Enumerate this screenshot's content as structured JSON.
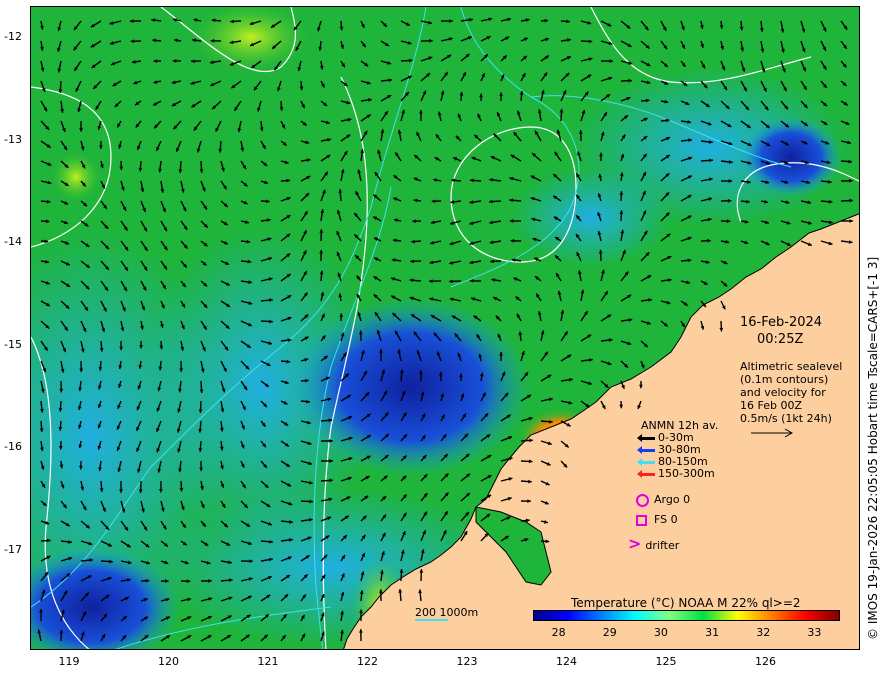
{
  "lat_ticks": [
    "-12",
    "-13",
    "-14",
    "-15",
    "-16",
    "-17"
  ],
  "lon_ticks": [
    "119",
    "120",
    "121",
    "122",
    "123",
    "124",
    "125",
    "126"
  ],
  "side_caption": "© IMOS 19-Jan-2026 22:05:05 Hobart time Tscale=CARS+[-1 3]",
  "date": "16-Feb-2024",
  "time": "00:25Z",
  "altimetry_lines": [
    "Altimetric sealevel",
    "(0.1m contours)",
    "and velocity for",
    "16 Feb 00Z",
    "0.5m/s (1kt 24h)"
  ],
  "legend": {
    "title": "ANMN 12h av.",
    "depths": [
      {
        "label": "0-30m",
        "color": "#000000"
      },
      {
        "label": "30-80m",
        "color": "#1040ff"
      },
      {
        "label": "80-150m",
        "color": "#40e0f0"
      },
      {
        "label": "150-300m",
        "color": "#ff2020"
      }
    ],
    "argo": "Argo 0",
    "fs": "FS 0",
    "drifter": "drifter"
  },
  "bathymetry_scale": "200  1000m",
  "colorbar": {
    "title": "Temperature (°C) NOAA   M 22% ql>=2",
    "ticks": [
      "28",
      "29",
      "30",
      "31",
      "32",
      "33"
    ],
    "range": [
      27.5,
      33.5
    ]
  },
  "colors": {
    "land": "#fdcf9f",
    "ocean_warm": "#1fb43a",
    "ocean_cool": "#18a8d8",
    "ocean_cold": "#1838c8",
    "hot": "#ff8800",
    "contour": "#ffffff",
    "bathymetry": "#40e0f0",
    "arrow": "#000000"
  }
}
